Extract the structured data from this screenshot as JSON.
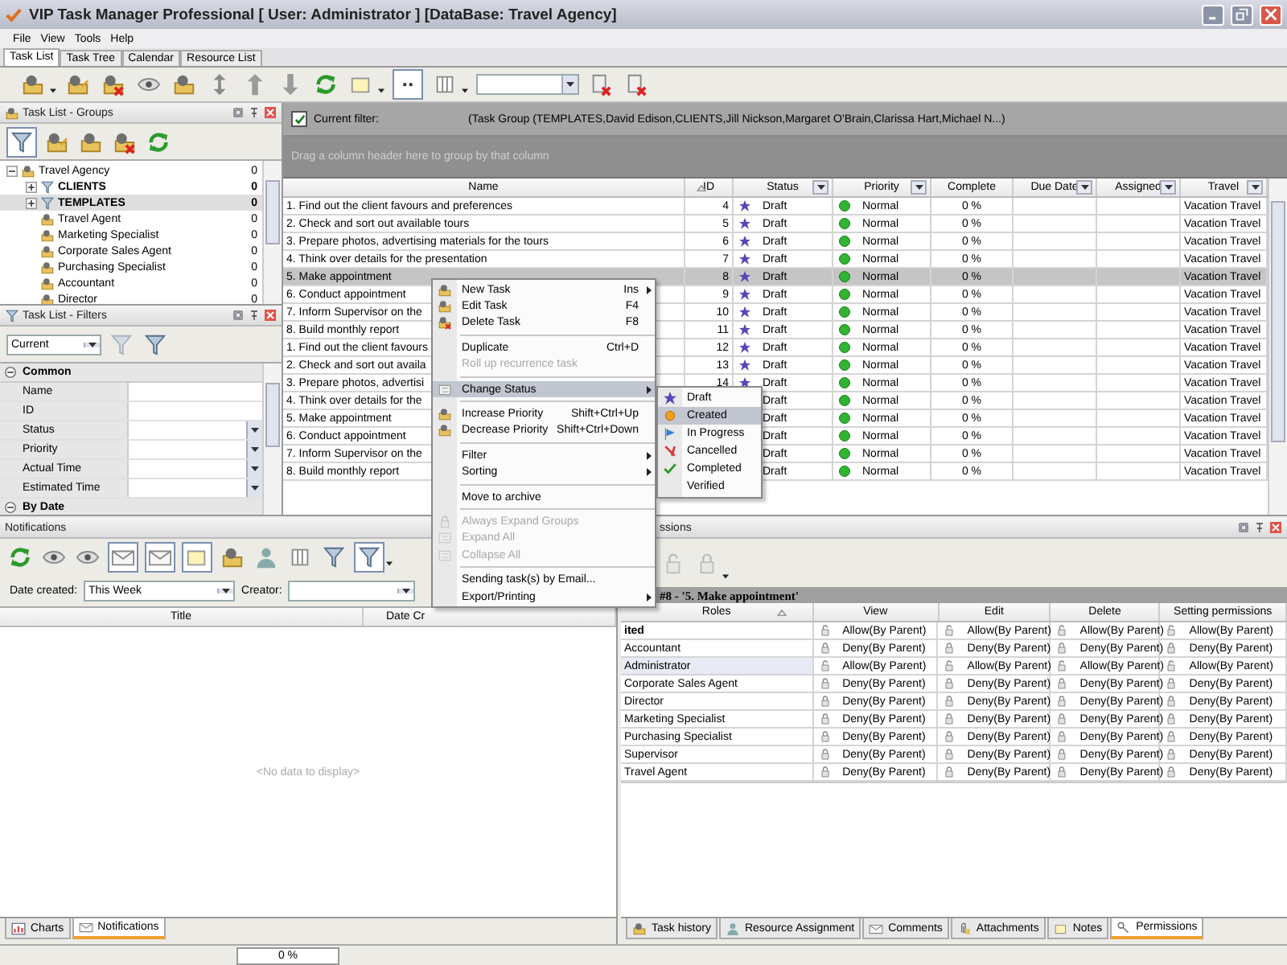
{
  "window": {
    "title": "VIP Task Manager Professional [ User: Administrator ] [DataBase: Travel Agency]"
  },
  "menu_bar": [
    "File",
    "View",
    "Tools",
    "Help"
  ],
  "tabs": [
    {
      "label": "Task List",
      "selected": true
    },
    {
      "label": "Task Tree",
      "selected": false
    },
    {
      "label": "Calendar",
      "selected": false
    },
    {
      "label": "Resource List",
      "selected": false
    }
  ],
  "groups_panel": {
    "title": "Task List - Groups",
    "tree": [
      {
        "label": "Travel Agency",
        "count": "0",
        "kind": "group",
        "expanded": true,
        "selected": false,
        "children": [
          {
            "label": "CLIENTS",
            "count": "0",
            "kind": "filter",
            "expanded": false,
            "selected": false
          },
          {
            "label": "TEMPLATES",
            "count": "0",
            "kind": "filter",
            "expanded": false,
            "selected": true
          },
          {
            "label": "Travel Agent",
            "count": "0",
            "kind": "group",
            "selected": false
          },
          {
            "label": "Marketing Specialist",
            "count": "0",
            "kind": "group",
            "selected": false
          },
          {
            "label": "Corporate Sales Agent",
            "count": "0",
            "kind": "group",
            "selected": false
          },
          {
            "label": "Purchasing Specialist",
            "count": "0",
            "kind": "group",
            "selected": false
          },
          {
            "label": "Accountant",
            "count": "0",
            "kind": "group",
            "selected": false
          },
          {
            "label": "Director",
            "count": "0",
            "kind": "group",
            "selected": false
          }
        ]
      }
    ]
  },
  "filters_panel": {
    "title": "Task List - Filters",
    "view": "Current",
    "categories": [
      {
        "label": "Common",
        "expanded": true,
        "rows": [
          {
            "label": "Name",
            "dropdown": false
          },
          {
            "label": "ID",
            "dropdown": false
          },
          {
            "label": "Status",
            "dropdown": true
          },
          {
            "label": "Priority",
            "dropdown": true
          },
          {
            "label": "Actual Time",
            "dropdown": true
          },
          {
            "label": "Estimated Time",
            "dropdown": true
          }
        ]
      },
      {
        "label": "By Date",
        "expanded": true
      }
    ]
  },
  "task_table": {
    "filter_enabled": true,
    "filter_label": "Current filter:",
    "filter_text": "(Task Group  (TEMPLATES,David Edison,CLIENTS,Jill Nickson,Margaret O'Brain,Clarissa Hart,Michael N...)",
    "group_hint": "Drag a column header here to group by that column",
    "columns": [
      {
        "label": "Name",
        "filter": false,
        "sorted": false
      },
      {
        "label": "ID",
        "filter": false,
        "sorted": true
      },
      {
        "label": "Status",
        "filter": true,
        "sorted": false
      },
      {
        "label": "Priority",
        "filter": true,
        "sorted": false
      },
      {
        "label": "Complete",
        "filter": false,
        "sorted": false
      },
      {
        "label": "Due Date",
        "filter": true,
        "sorted": false
      },
      {
        "label": "Assigned",
        "filter": true,
        "sorted": false
      },
      {
        "label": "Travel",
        "filter": true,
        "sorted": false
      }
    ],
    "rows": [
      {
        "name": "1. Find out the client favours and preferences",
        "id": "4",
        "status": "Draft",
        "priority": "Normal",
        "complete": "0 %",
        "travel": "Vacation Travel",
        "selected": false
      },
      {
        "name": "2. Check and sort out available tours",
        "id": "5",
        "status": "Draft",
        "priority": "Normal",
        "complete": "0 %",
        "travel": "Vacation Travel",
        "selected": false
      },
      {
        "name": "3. Prepare photos, advertising materials for the tours",
        "id": "6",
        "status": "Draft",
        "priority": "Normal",
        "complete": "0 %",
        "travel": "Vacation Travel",
        "selected": false
      },
      {
        "name": "4. Think over details for the presentation",
        "id": "7",
        "status": "Draft",
        "priority": "Normal",
        "complete": "0 %",
        "travel": "Vacation Travel",
        "selected": false
      },
      {
        "name": "5. Make appointment",
        "id": "8",
        "status": "Draft",
        "priority": "Normal",
        "complete": "0 %",
        "travel": "Vacation Travel",
        "selected": true
      },
      {
        "name": "6. Conduct appointment",
        "id": "9",
        "status": "Draft",
        "priority": "Normal",
        "complete": "0 %",
        "travel": "Vacation Travel",
        "selected": false
      },
      {
        "name": "7. Inform Supervisor on the",
        "id": "10",
        "status": "Draft",
        "priority": "Normal",
        "complete": "0 %",
        "travel": "Vacation Travel",
        "selected": false
      },
      {
        "name": "8. Build monthly report",
        "id": "11",
        "status": "Draft",
        "priority": "Normal",
        "complete": "0 %",
        "travel": "Vacation Travel",
        "selected": false
      },
      {
        "name": "1. Find out the client favours",
        "id": "12",
        "status": "Draft",
        "priority": "Normal",
        "complete": "0 %",
        "travel": "Vacation Travel",
        "selected": false
      },
      {
        "name": "2. Check and sort out availa",
        "id": "13",
        "status": "Draft",
        "priority": "Normal",
        "complete": "0 %",
        "travel": "Vacation Travel",
        "selected": false
      },
      {
        "name": "3. Prepare photos, advertisi",
        "id": "14",
        "status": "Draft",
        "priority": "Normal",
        "complete": "0 %",
        "travel": "Vacation Travel",
        "selected": false
      },
      {
        "name": "4. Think over details for the",
        "status": "Draft",
        "priority": "Normal",
        "complete": "0 %",
        "travel": "Vacation Travel",
        "selected": false
      },
      {
        "name": "5. Make appointment",
        "status": "Draft",
        "priority": "Normal",
        "complete": "0 %",
        "travel": "Vacation Travel",
        "selected": false
      },
      {
        "name": "6. Conduct appointment",
        "status": "Draft",
        "priority": "Normal",
        "complete": "0 %",
        "travel": "Vacation Travel",
        "selected": false
      },
      {
        "name": "7. Inform Supervisor on the",
        "status": "Draft",
        "priority": "Normal",
        "complete": "0 %",
        "travel": "Vacation Travel",
        "selected": false
      },
      {
        "name": "8. Build monthly report",
        "status": "Draft",
        "priority": "Normal",
        "complete": "0 %",
        "travel": "Vacation Travel",
        "selected": false
      }
    ]
  },
  "context_menu": [
    {
      "kind": "item",
      "label": "New Task",
      "shortcut": "Ins",
      "submenu": true,
      "disabled": false,
      "selected": false
    },
    {
      "kind": "item",
      "label": "Edit Task",
      "shortcut": "F4",
      "submenu": false,
      "disabled": false,
      "selected": false
    },
    {
      "kind": "item",
      "label": "Delete Task",
      "shortcut": "F8",
      "submenu": false,
      "disabled": false,
      "selected": false
    },
    {
      "kind": "separator"
    },
    {
      "kind": "item",
      "label": "Duplicate",
      "shortcut": "Ctrl+D",
      "submenu": false,
      "disabled": false,
      "selected": false
    },
    {
      "kind": "item",
      "label": "Roll up recurrence task",
      "submenu": false,
      "disabled": true,
      "selected": false
    },
    {
      "kind": "separator"
    },
    {
      "kind": "item",
      "label": "Change Status",
      "submenu": true,
      "disabled": false,
      "selected": true
    },
    {
      "kind": "separator"
    },
    {
      "kind": "item",
      "label": "Increase Priority",
      "shortcut": "Shift+Ctrl+Up",
      "submenu": false,
      "disabled": false,
      "selected": false
    },
    {
      "kind": "item",
      "label": "Decrease Priority",
      "shortcut": "Shift+Ctrl+Down",
      "submenu": false,
      "disabled": false,
      "selected": false
    },
    {
      "kind": "separator"
    },
    {
      "kind": "item",
      "label": "Filter",
      "submenu": true,
      "disabled": false,
      "selected": false
    },
    {
      "kind": "item",
      "label": "Sorting",
      "submenu": true,
      "disabled": false,
      "selected": false
    },
    {
      "kind": "separator"
    },
    {
      "kind": "item",
      "label": "Move to archive",
      "submenu": false,
      "disabled": false,
      "selected": false
    },
    {
      "kind": "separator"
    },
    {
      "kind": "item",
      "label": "Always Expand Groups",
      "submenu": false,
      "disabled": true,
      "selected": false
    },
    {
      "kind": "item",
      "label": "Expand All",
      "submenu": false,
      "disabled": true,
      "selected": false
    },
    {
      "kind": "item",
      "label": "Collapse All",
      "submenu": false,
      "disabled": true,
      "selected": false
    },
    {
      "kind": "separator"
    },
    {
      "kind": "item",
      "label": "Sending task(s) by Email...",
      "submenu": false,
      "disabled": false,
      "selected": false
    },
    {
      "kind": "item",
      "label": "Export/Printing",
      "submenu": true,
      "disabled": false,
      "selected": false
    }
  ],
  "status_submenu": [
    {
      "label": "Draft",
      "selected": false
    },
    {
      "label": "Created",
      "selected": true
    },
    {
      "label": "In Progress",
      "selected": false
    },
    {
      "label": "Cancelled",
      "selected": false
    },
    {
      "label": "Completed",
      "selected": false
    },
    {
      "label": "Verified",
      "selected": false
    }
  ],
  "notifications_panel": {
    "title": "Notifications",
    "date_label": "Date created:",
    "date_value": "This Week",
    "creator_label": "Creator:",
    "columns": [
      "Title",
      "Date Cr"
    ],
    "empty_text": "<No data to display>",
    "tabs": [
      {
        "label": "Charts",
        "selected": false
      },
      {
        "label": "Notifications",
        "selected": true
      }
    ]
  },
  "permissions_panel": {
    "title": "ssions",
    "caption": "#8 - '5. Make appointment'",
    "columns": [
      {
        "label": "Roles",
        "sorted": true
      },
      {
        "label": "View",
        "sorted": false
      },
      {
        "label": "Edit",
        "sorted": false
      },
      {
        "label": "Delete",
        "sorted": false
      },
      {
        "label": "Setting permissions",
        "sorted": false
      }
    ],
    "rows": [
      {
        "bold": true,
        "selected": false,
        "allowed": true,
        "cells": [
          "ited",
          "Allow(By Parent)",
          "Allow(By Parent)",
          "Allow(By Parent)",
          "Allow(By Parent)"
        ]
      },
      {
        "bold": false,
        "selected": false,
        "allowed": false,
        "cells": [
          "Accountant",
          "Deny(By Parent)",
          "Deny(By Parent)",
          "Deny(By Parent)",
          "Deny(By Parent)"
        ]
      },
      {
        "bold": false,
        "selected": true,
        "allowed": true,
        "cells": [
          "Administrator",
          "Allow(By Parent)",
          "Allow(By Parent)",
          "Allow(By Parent)",
          "Allow(By Parent)"
        ]
      },
      {
        "bold": false,
        "selected": false,
        "allowed": false,
        "cells": [
          "Corporate Sales Agent",
          "Deny(By Parent)",
          "Deny(By Parent)",
          "Deny(By Parent)",
          "Deny(By Parent)"
        ]
      },
      {
        "bold": false,
        "selected": false,
        "allowed": false,
        "cells": [
          "Director",
          "Deny(By Parent)",
          "Deny(By Parent)",
          "Deny(By Parent)",
          "Deny(By Parent)"
        ]
      },
      {
        "bold": false,
        "selected": false,
        "allowed": false,
        "cells": [
          "Marketing Specialist",
          "Deny(By Parent)",
          "Deny(By Parent)",
          "Deny(By Parent)",
          "Deny(By Parent)"
        ]
      },
      {
        "bold": false,
        "selected": false,
        "allowed": false,
        "cells": [
          "Purchasing Specialist",
          "Deny(By Parent)",
          "Deny(By Parent)",
          "Deny(By Parent)",
          "Deny(By Parent)"
        ]
      },
      {
        "bold": false,
        "selected": false,
        "allowed": false,
        "cells": [
          "Supervisor",
          "Deny(By Parent)",
          "Deny(By Parent)",
          "Deny(By Parent)",
          "Deny(By Parent)"
        ]
      },
      {
        "bold": false,
        "selected": false,
        "allowed": false,
        "cells": [
          "Travel Agent",
          "Deny(By Parent)",
          "Deny(By Parent)",
          "Deny(By Parent)",
          "Deny(By Parent)"
        ]
      }
    ],
    "tabs": [
      {
        "label": "Task history",
        "selected": false
      },
      {
        "label": "Resource Assignment",
        "selected": false
      },
      {
        "label": "Comments",
        "selected": false
      },
      {
        "label": "Attachments",
        "selected": false
      },
      {
        "label": "Notes",
        "selected": false
      },
      {
        "label": "Permissions",
        "selected": true
      }
    ]
  },
  "status_bar": {
    "progress": "0 %"
  }
}
